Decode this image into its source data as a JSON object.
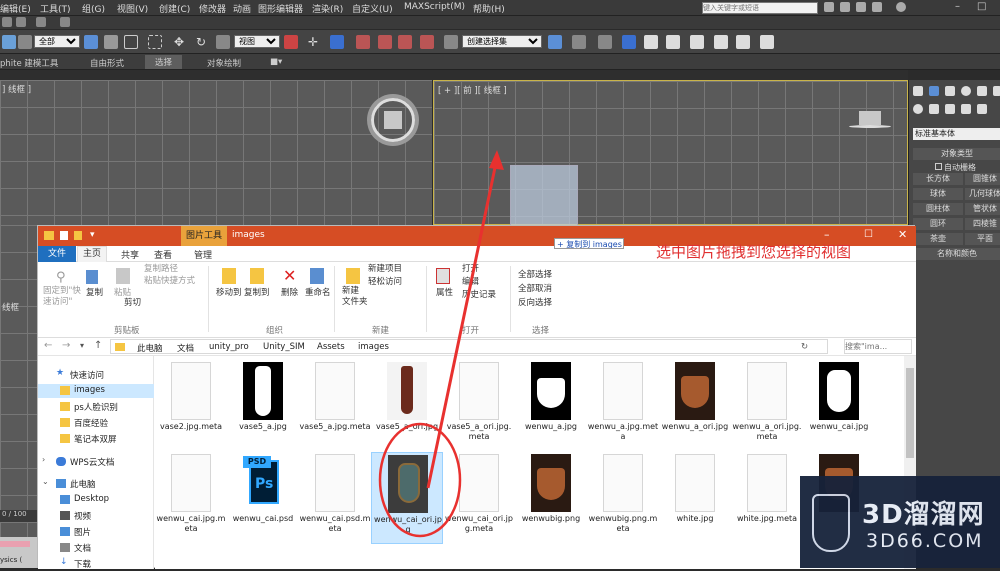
{
  "max": {
    "search_placeholder": "键入关键字或短语",
    "menu": [
      {
        "label": "编辑(E)"
      },
      {
        "label": "工具(T)"
      },
      {
        "label": "组(G)"
      },
      {
        "label": "视图(V)"
      },
      {
        "label": "创建(C)"
      },
      {
        "label": "修改器"
      },
      {
        "label": "动画"
      },
      {
        "label": "图形编辑器"
      },
      {
        "label": "渲染(R)"
      },
      {
        "label": "自定义(U)"
      },
      {
        "label": "MAXScript(M)"
      },
      {
        "label": "帮助(H)"
      }
    ],
    "toolbar": {
      "selection_filter": "全部",
      "ref_coord": "视图",
      "named_selection": "创建选择集"
    },
    "ribbon_tabs": [
      {
        "label": "phite 建模工具"
      },
      {
        "label": "自由形式"
      },
      {
        "label": "选择"
      },
      {
        "label": "对象绘制"
      }
    ],
    "viewport_left_label": "] 线框 ]",
    "viewport_front_label": "[ + ][ 前 ][ 线框 ]",
    "viewport_bl_label": "线框",
    "timeline_text": "0 / 100",
    "status_text": "ysics (",
    "command_panel": {
      "dropdown": "标准基本体",
      "rollout_title": "对象类型",
      "autogrid": "自动栅格",
      "buttons": [
        {
          "label": "长方体"
        },
        {
          "label": "圆锥体"
        },
        {
          "label": "球体"
        },
        {
          "label": "几何球体"
        },
        {
          "label": "圆柱体"
        },
        {
          "label": "管状体"
        },
        {
          "label": "圆环"
        },
        {
          "label": "四棱锥"
        },
        {
          "label": "茶壶"
        },
        {
          "label": "平面"
        }
      ],
      "name_color": "名称和颜色"
    }
  },
  "explorer": {
    "context_tab": "图片工具",
    "title": "images",
    "tabs": [
      {
        "label": "文件"
      },
      {
        "label": "主页"
      },
      {
        "label": "共享"
      },
      {
        "label": "查看"
      },
      {
        "label": "管理"
      }
    ],
    "ribbon": {
      "pin_quick": "固定到\"快\n速访问\"",
      "copy": "复制",
      "paste": "粘贴",
      "copy_path": "复制路径",
      "paste_shortcut": "粘贴快捷方式",
      "cut": "剪切",
      "move_to": "移动到",
      "copy_to": "复制到",
      "delete": "删除",
      "rename": "重命名",
      "new_folder": "新建\n文件夹",
      "new_item": "新建项目",
      "easy_access": "轻松访问",
      "properties": "属性",
      "open": "打开",
      "edit": "编辑",
      "history": "历史记录",
      "select_all": "全部选择",
      "select_none": "全部取消",
      "invert": "反向选择",
      "group_clipboard": "剪贴板",
      "group_organize": "组织",
      "group_new": "新建",
      "group_open": "打开",
      "group_select": "选择"
    },
    "breadcrumb": [
      {
        "label": "此电脑"
      },
      {
        "label": "文档"
      },
      {
        "label": "unity_pro"
      },
      {
        "label": "Unity_SIM"
      },
      {
        "label": "Assets"
      },
      {
        "label": "images"
      }
    ],
    "search_placeholder": "搜索\"ima...",
    "nav": [
      {
        "label": "快速访问"
      },
      {
        "label": "images"
      },
      {
        "label": "ps人脸识别"
      },
      {
        "label": "百度经验"
      },
      {
        "label": "笔记本双屏"
      },
      {
        "label": "WPS云文档"
      },
      {
        "label": "此电脑"
      },
      {
        "label": "Desktop"
      },
      {
        "label": "视频"
      },
      {
        "label": "图片"
      },
      {
        "label": "文档"
      },
      {
        "label": "下载"
      }
    ],
    "files": [
      {
        "name": "vase2.jpg.meta",
        "kind": "doc"
      },
      {
        "name": "vase5_a.jpg",
        "kind": "img-vase-bw"
      },
      {
        "name": "vase5_a.jpg.meta",
        "kind": "doc"
      },
      {
        "name": "vase5_a_ori.jpg",
        "kind": "img-vase-red"
      },
      {
        "name": "vase5_a_ori.jpg.meta",
        "kind": "doc"
      },
      {
        "name": "wenwu_a.jpg",
        "kind": "img-pot-bw"
      },
      {
        "name": "wenwu_a.jpg.meta",
        "kind": "doc"
      },
      {
        "name": "wenwu_a_ori.jpg",
        "kind": "img-pot-brown"
      },
      {
        "name": "wenwu_a_ori.jpg.meta",
        "kind": "doc"
      },
      {
        "name": "wenwu_cai.jpg",
        "kind": "img-jar-bw"
      },
      {
        "name": "wenwu_cai.jpg.meta",
        "kind": "doc"
      },
      {
        "name": "wenwu_cai.psd",
        "kind": "psd"
      },
      {
        "name": "wenwu_cai.psd.meta",
        "kind": "doc"
      },
      {
        "name": "wenwu_cai_ori.jpg",
        "kind": "img-jar-color"
      },
      {
        "name": "wenwu_cai_ori.jpg.meta",
        "kind": "doc"
      },
      {
        "name": "wenwubig.png",
        "kind": "img-pot-brown"
      },
      {
        "name": "wenwubig.png.meta",
        "kind": "doc"
      },
      {
        "name": "white.jpg",
        "kind": "doc"
      },
      {
        "name": "white.jpg.meta",
        "kind": "doc"
      },
      {
        "name": "",
        "kind": "img-pot-brown"
      }
    ]
  },
  "drag_hint": "+ 复制到 images",
  "annotation": "选中图片拖拽到您选择的视图",
  "watermark": {
    "brand": "3D溜溜网",
    "url": "3D66.COM"
  },
  "colors": {
    "explorer_title": "#d64d24",
    "file_tab": "#1f6fbf",
    "annotation": "#e03030",
    "selection": "#cce8ff"
  }
}
